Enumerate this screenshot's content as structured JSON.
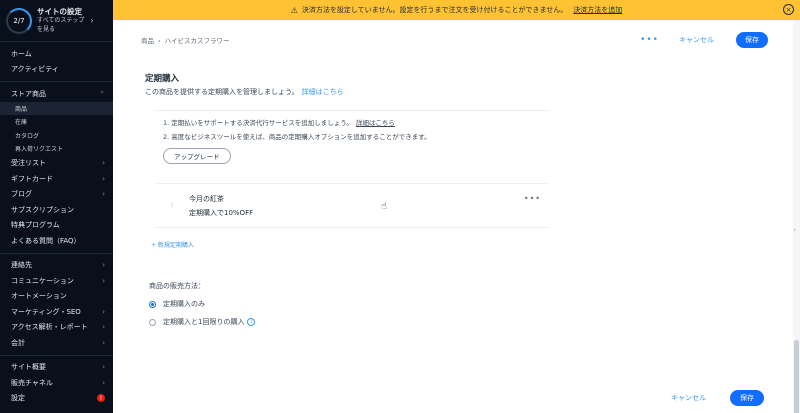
{
  "sidebar": {
    "progress": "2/7",
    "setup_title": "サイトの設定",
    "setup_sub1": "すべてのステップ",
    "setup_sub2": "を見る",
    "group1": [
      "ホーム",
      "アクティビティ"
    ],
    "store": {
      "label": "ストア商品",
      "subs": [
        "商品",
        "在庫",
        "カタログ",
        "再入荷リクエスト"
      ]
    },
    "group2": [
      "受注リスト",
      "ギフトカード",
      "ブログ",
      "サブスクリプション",
      "特典プログラム",
      "よくある質問（FAQ）"
    ],
    "group3": [
      "連絡先",
      "コミュニケーション",
      "オートメーション",
      "マーケティング・SEO",
      "アクセス解析・レポート",
      "会計"
    ],
    "group4": [
      "サイト概要",
      "販売チャネル",
      "設定"
    ],
    "settings_badge": "!"
  },
  "banner": {
    "text": "決済方法を設定していません。設定を行うまで注文を受け付けることができません。",
    "link": "決済方法を追加"
  },
  "breadcrumb": {
    "root": "商品",
    "separator": "›",
    "current": "ハイビスカスフラワー"
  },
  "actions": {
    "more": "•••",
    "cancel": "キャンセル",
    "save": "保存"
  },
  "section": {
    "title": "定期購入",
    "subtitle": "この商品を提供する定期購入を管理しましょう。",
    "subtitle_link": "詳細はこちら"
  },
  "upsell": {
    "line1": "1. 定期払いをサポートする決済代行サービスを追加しましょう。",
    "line1_link": "詳細はこちら",
    "line2": "2. 高度なビジネスツールを使えば、商品の定期購入オプションを追加することができます。",
    "button": "アップグレード"
  },
  "plan": {
    "name": "今月の紅茶",
    "desc": "定期購入で10%OFF",
    "more": "•••"
  },
  "add_plan": "+ 新規定期購入",
  "sell": {
    "label": "商品の販売方法：",
    "option1": "定期購入のみ",
    "option2": "定期購入と1回限りの購入"
  }
}
